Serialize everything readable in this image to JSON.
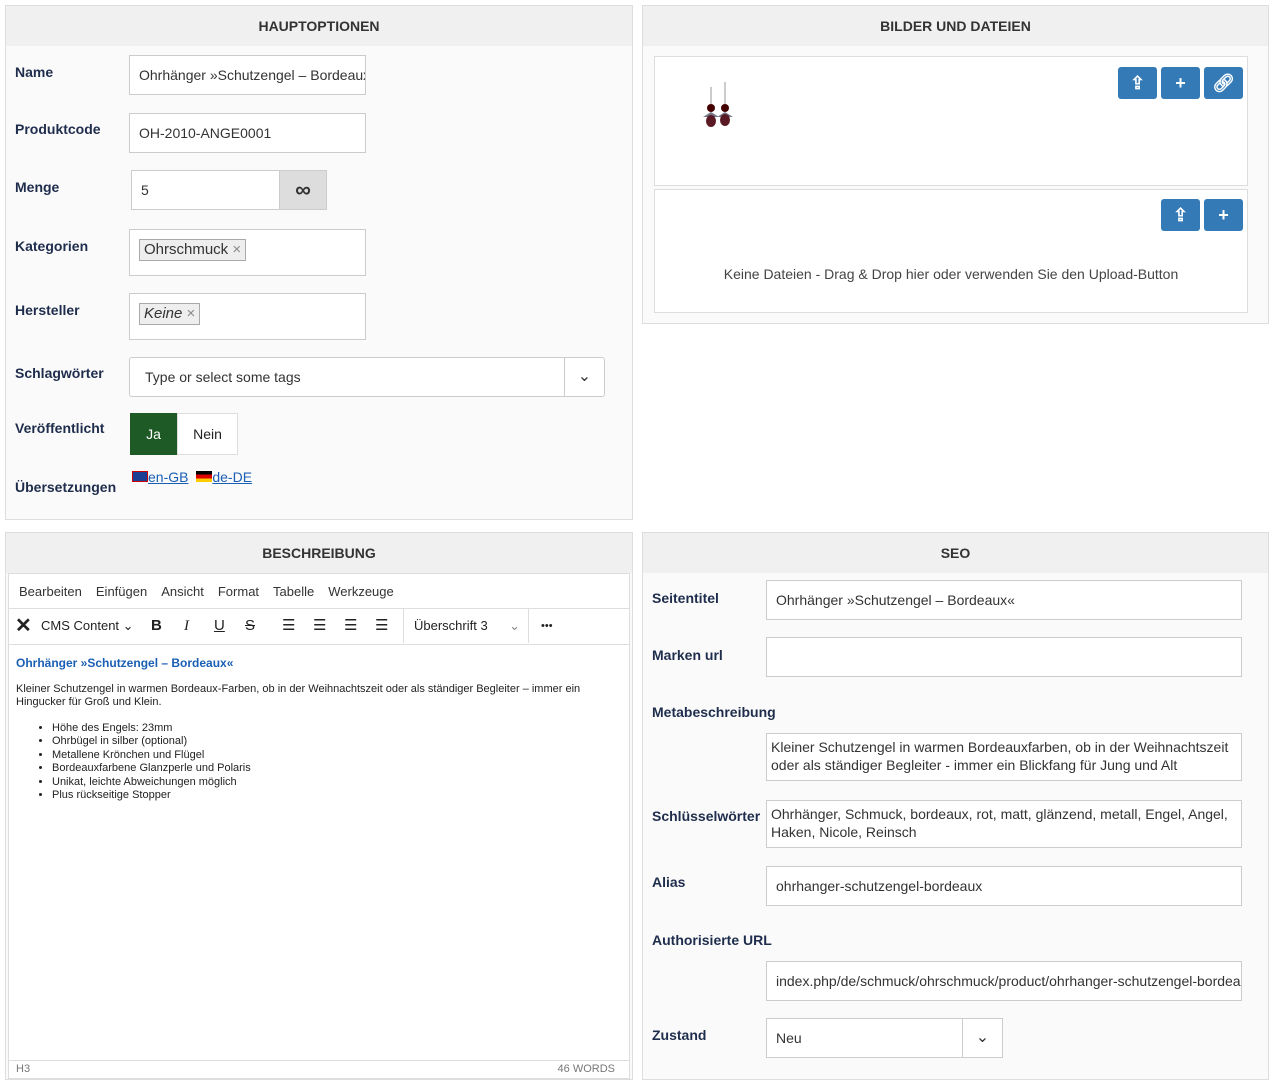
{
  "main": {
    "title": "HAUPTOPTIONEN",
    "name_label": "Name",
    "name_value": "Ohrhänger »Schutzengel – Bordeaux«",
    "code_label": "Produktcode",
    "code_value": "OH-2010-ANGE0001",
    "qty_label": "Menge",
    "qty_value": "5",
    "infinity": "∞",
    "cat_label": "Kategorien",
    "cat_chip": "Ohrschmuck",
    "maker_label": "Hersteller",
    "maker_chip": "Keine",
    "tags_label": "Schlagwörter",
    "tags_placeholder": "Type or select some tags",
    "pub_label": "Veröffentlicht",
    "pub_yes": "Ja",
    "pub_no": "Nein",
    "trans_label": "Übersetzungen",
    "trans": [
      "en-GB",
      "de-DE"
    ]
  },
  "files": {
    "title": "BILDER UND DATEIEN",
    "empty": "Keine Dateien - Drag & Drop hier oder verwenden Sie den Upload-Button"
  },
  "desc": {
    "title": "BESCHREIBUNG",
    "menu": [
      "Bearbeiten",
      "Einfügen",
      "Ansicht",
      "Format",
      "Tabelle",
      "Werkzeuge"
    ],
    "cms": "CMS Content",
    "block": "Überschrift 3",
    "more": "•••",
    "heading": "Ohrhänger »Schutzengel – Bordeaux«",
    "para": "Kleiner Schutzengel in warmen Bordeaux-Farben, ob in der Weihnachtszeit oder als ständiger Begleiter – immer ein Hingucker für Groß und Klein.",
    "bullets": [
      "Höhe des Engels: 23mm",
      "Ohrbügel in silber (optional)",
      "Metallene Krönchen und Flügel",
      "Bordeauxfarbene Glanzperle und Polaris",
      "Unikat, leichte Abweichungen möglich",
      "Plus rückseitige Stopper"
    ],
    "status_path": "H3",
    "word_count": "46 WORDS"
  },
  "seo": {
    "title": "SEO",
    "page_title_label": "Seitentitel",
    "page_title_value": "Ohrhänger »Schutzengel – Bordeaux«",
    "brand_url_label": "Marken url",
    "brand_url_value": "",
    "meta_label": "Metabeschreibung",
    "meta_value": "Kleiner Schutzengel in warmen Bordeauxfarben, ob in der Weihnachtszeit oder als ständiger Begleiter - immer ein Blickfang für Jung und Alt",
    "keywords_label": "Schlüsselwörter",
    "keywords_value": "Ohrhänger, Schmuck, bordeaux, rot, matt, glänzend, metall, Engel, Angel, Haken, Nicole, Reinsch",
    "alias_label": "Alias",
    "alias_value": "ohrhanger-schutzengel-bordeaux",
    "auth_label": "Authorisierte URL",
    "auth_value": "index.php/de/schmuck/ohrschmuck/product/ohrhanger-schutzengel-bordeaux",
    "state_label": "Zustand",
    "state_value": "Neu"
  }
}
